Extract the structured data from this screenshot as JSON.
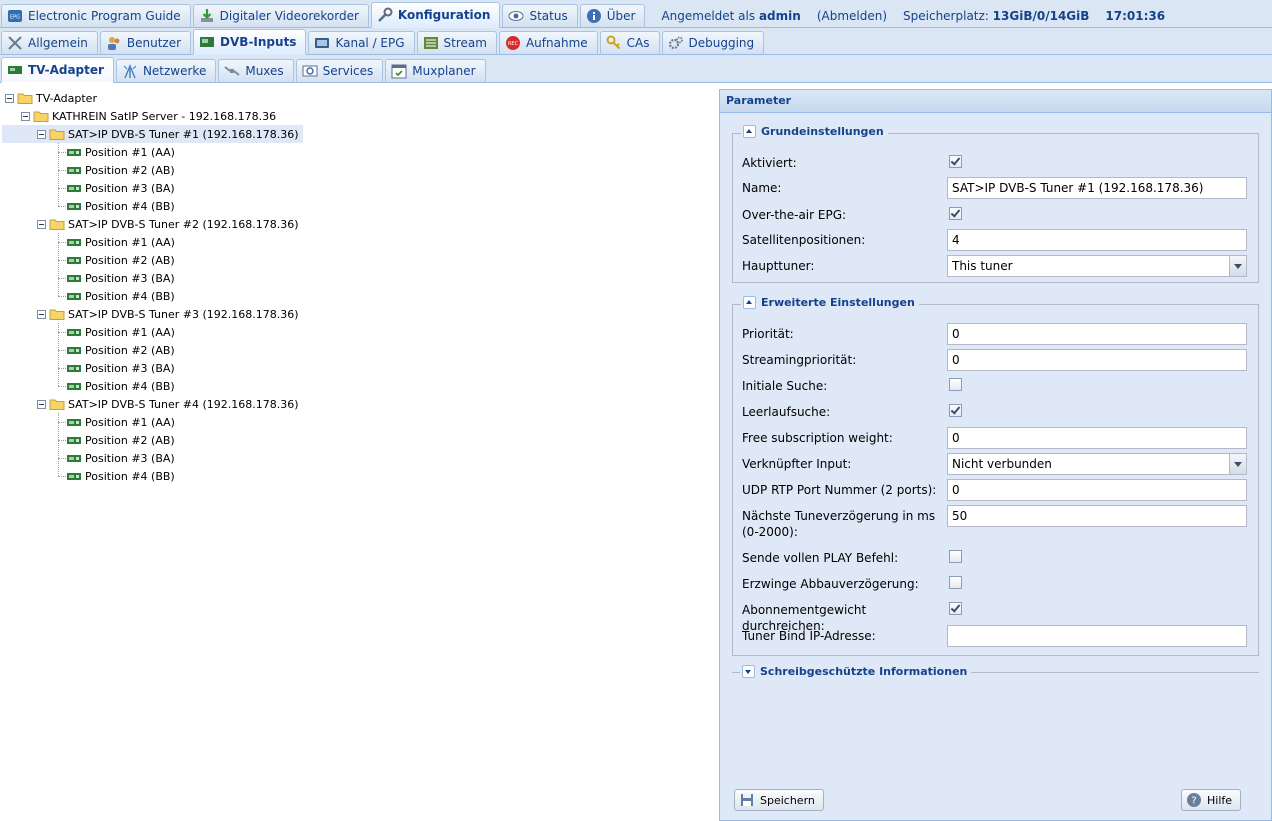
{
  "top_tabs": [
    {
      "label": "Electronic Program Guide",
      "icon": "epg-icon",
      "active": false
    },
    {
      "label": "Digitaler Videorekorder",
      "icon": "download-icon",
      "active": false
    },
    {
      "label": "Konfiguration",
      "icon": "wrench-icon",
      "active": true
    },
    {
      "label": "Status",
      "icon": "eye-icon",
      "active": false
    },
    {
      "label": "Über",
      "icon": "info-icon",
      "active": false
    }
  ],
  "status": {
    "logged_in_prefix": "Angemeldet als",
    "user": "admin",
    "logout": "(Abmelden)",
    "storage_label": "Speicherplatz:",
    "storage_value": "13GiB/0/14GiB",
    "time": "17:01:36"
  },
  "config_tabs": [
    {
      "label": "Allgemein"
    },
    {
      "label": "Benutzer"
    },
    {
      "label": "DVB-Inputs",
      "active": true
    },
    {
      "label": "Kanal / EPG"
    },
    {
      "label": "Stream"
    },
    {
      "label": "Aufnahme"
    },
    {
      "label": "CAs"
    },
    {
      "label": "Debugging"
    }
  ],
  "dvb_tabs": [
    {
      "label": "TV-Adapter",
      "active": true
    },
    {
      "label": "Netzwerke"
    },
    {
      "label": "Muxes"
    },
    {
      "label": "Services"
    },
    {
      "label": "Muxplaner"
    }
  ],
  "tree": {
    "root": "TV-Adapter",
    "server": "KATHREIN SatIP Server - 192.168.178.36",
    "tuners": [
      {
        "label": "SAT>IP DVB-S Tuner #1 (192.168.178.36)",
        "selected": true,
        "positions": [
          "Position #1 (AA)",
          "Position #2 (AB)",
          "Position #3 (BA)",
          "Position #4 (BB)"
        ]
      },
      {
        "label": "SAT>IP DVB-S Tuner #2 (192.168.178.36)",
        "positions": [
          "Position #1 (AA)",
          "Position #2 (AB)",
          "Position #3 (BA)",
          "Position #4 (BB)"
        ]
      },
      {
        "label": "SAT>IP DVB-S Tuner #3 (192.168.178.36)",
        "positions": [
          "Position #1 (AA)",
          "Position #2 (AB)",
          "Position #3 (BA)",
          "Position #4 (BB)"
        ]
      },
      {
        "label": "SAT>IP DVB-S Tuner #4 (192.168.178.36)",
        "positions": [
          "Position #1 (AA)",
          "Position #2 (AB)",
          "Position #3 (BA)",
          "Position #4 (BB)"
        ]
      }
    ]
  },
  "panel": {
    "title": "Parameter",
    "basic": {
      "title": "Grundeinstellungen",
      "aktiviert": {
        "label": "Aktiviert:",
        "checked": true
      },
      "name": {
        "label": "Name:",
        "value": "SAT>IP DVB-S Tuner #1 (192.168.178.36)"
      },
      "ota_epg": {
        "label": "Over-the-air EPG:",
        "checked": true
      },
      "satpos": {
        "label": "Satellitenpositionen:",
        "value": "4"
      },
      "haupttuner": {
        "label": "Haupttuner:",
        "value": "This tuner"
      }
    },
    "advanced": {
      "title": "Erweiterte Einstellungen",
      "prio": {
        "label": "Priorität:",
        "value": "0"
      },
      "streamprio": {
        "label": "Streamingpriorität:",
        "value": "0"
      },
      "initial": {
        "label": "Initiale Suche:",
        "checked": false
      },
      "idle": {
        "label": "Leerlaufsuche:",
        "checked": true
      },
      "freeweight": {
        "label": "Free subscription weight:",
        "value": "0"
      },
      "linked": {
        "label": "Verknüpfter Input:",
        "value": "Nicht verbunden"
      },
      "udp": {
        "label": "UDP RTP Port Nummer (2 ports):",
        "value": "0"
      },
      "tunedelay": {
        "label": "Nächste Tuneverzögerung in ms (0-2000):",
        "value": "50"
      },
      "fullplay": {
        "label": "Sende vollen PLAY Befehl:",
        "checked": false
      },
      "teardown": {
        "label": "Erzwinge Abbauverzögerung:",
        "checked": false
      },
      "passweight": {
        "label": "Abonnementgewicht durchreichen:",
        "checked": true
      },
      "bindip": {
        "label": "Tuner Bind IP-Adresse:",
        "value": ""
      }
    },
    "readonly": {
      "title": "Schreibgeschützte Informationen"
    },
    "save": "Speichern",
    "help": "Hilfe"
  },
  "colors": {
    "accent": "#15428b",
    "tab_bg": "#dbe6f4",
    "border": "#99bbe8",
    "panel_bg": "#dfe8f6"
  }
}
